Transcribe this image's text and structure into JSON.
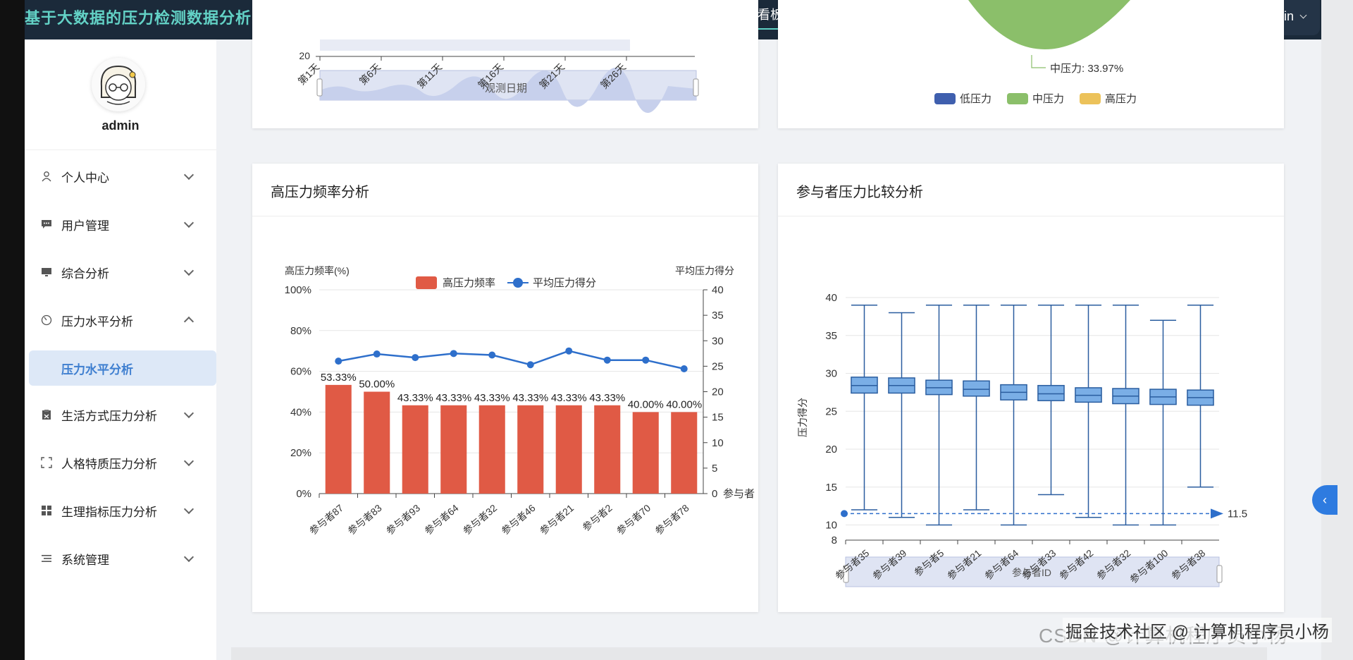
{
  "header": {
    "app_title": "基于大数据的压力检测数据分析系统",
    "dashboard_button": "数据看板",
    "user_name": "admin"
  },
  "sidebar": {
    "user_name": "admin",
    "items": [
      {
        "label": "个人中心",
        "icon": "user-icon",
        "expanded": false
      },
      {
        "label": "用户管理",
        "icon": "chat-icon",
        "expanded": false
      },
      {
        "label": "综合分析",
        "icon": "monitor-icon",
        "expanded": false
      },
      {
        "label": "压力水平分析",
        "icon": "gauge-icon",
        "expanded": true
      },
      {
        "label": "生活方式压力分析",
        "icon": "clipboard-icon",
        "expanded": false
      },
      {
        "label": "人格特质压力分析",
        "icon": "frame-icon",
        "expanded": false
      },
      {
        "label": "生理指标压力分析",
        "icon": "grid-icon",
        "expanded": false
      },
      {
        "label": "系统管理",
        "icon": "list-icon",
        "expanded": false
      }
    ],
    "active_subitem": "压力水平分析"
  },
  "top_left_chart": {
    "y_tick": "20",
    "x_ticks": [
      "第1天",
      "第6天",
      "第11天",
      "第16天",
      "第21天",
      "第26天"
    ],
    "x_label": "观测日期"
  },
  "top_right_chart": {
    "pie_label": "中压力: 33.97%",
    "legend": [
      {
        "name": "低压力",
        "color": "#3f5fae"
      },
      {
        "name": "中压力",
        "color": "#8bbf6a"
      },
      {
        "name": "高压力",
        "color": "#ecc25a"
      }
    ]
  },
  "cards": {
    "high_freq_title": "高压力频率分析",
    "compare_title": "参与者压力比较分析"
  },
  "chart_data": [
    {
      "type": "bar",
      "title": "高压力频率分析",
      "ylabel": "高压力频率(%)",
      "y2label": "平均压力得分",
      "ylim": [
        0,
        100
      ],
      "y2lim": [
        0,
        40
      ],
      "y_ticks": [
        "0%",
        "20%",
        "40%",
        "60%",
        "80%",
        "100%"
      ],
      "y2_ticks": [
        "0",
        "5",
        "10",
        "15",
        "20",
        "25",
        "30",
        "35",
        "40"
      ],
      "y2_axis_name_bottom": "参与者",
      "categories": [
        "参与者87",
        "参与者83",
        "参与者93",
        "参与者64",
        "参与者32",
        "参与者46",
        "参与者21",
        "参与者2",
        "参与者70",
        "参与者78"
      ],
      "legend": [
        "高压力频率",
        "平均压力得分"
      ],
      "series": [
        {
          "name": "高压力频率",
          "type": "bar",
          "values": [
            53.33,
            50.0,
            43.33,
            43.33,
            43.33,
            43.33,
            43.33,
            43.33,
            40.0,
            40.0
          ],
          "labels": [
            "53.33%",
            "50.00%",
            "43.33%",
            "43.33%",
            "43.33%",
            "43.33%",
            "43.33%",
            "43.33%",
            "40.00%",
            "40.00%"
          ]
        },
        {
          "name": "平均压力得分",
          "type": "line",
          "values": [
            26.0,
            27.4,
            26.7,
            27.5,
            27.2,
            25.3,
            28.0,
            26.2,
            26.2,
            24.5
          ]
        }
      ],
      "colors": {
        "bar": "#e05a45",
        "line": "#2e6fcb"
      }
    },
    {
      "type": "boxplot",
      "title": "参与者压力比较分析",
      "ylabel": "压力得分",
      "xlabel": "参与者ID",
      "ylim": [
        8,
        40
      ],
      "y_ticks": [
        "8",
        "10",
        "15",
        "20",
        "25",
        "30",
        "35",
        "40"
      ],
      "categories": [
        "参与者35",
        "参与者39",
        "参与者5",
        "参与者21",
        "参与者64",
        "参与者33",
        "参与者42",
        "参与者32",
        "参与者100",
        "参与者38"
      ],
      "boxes": [
        {
          "min": 12,
          "q1": 27.4,
          "median": 28.4,
          "q3": 29.5,
          "max": 39
        },
        {
          "min": 11,
          "q1": 27.4,
          "median": 28.4,
          "q3": 29.4,
          "max": 38
        },
        {
          "min": 10,
          "q1": 27.2,
          "median": 28.1,
          "q3": 29.1,
          "max": 39
        },
        {
          "min": 12,
          "q1": 27.0,
          "median": 27.9,
          "q3": 29.0,
          "max": 39
        },
        {
          "min": 10,
          "q1": 26.5,
          "median": 27.5,
          "q3": 28.5,
          "max": 39
        },
        {
          "min": 14,
          "q1": 26.4,
          "median": 27.3,
          "q3": 28.4,
          "max": 39
        },
        {
          "min": 11,
          "q1": 26.2,
          "median": 27.1,
          "q3": 28.1,
          "max": 39
        },
        {
          "min": 10,
          "q1": 26.0,
          "median": 27.0,
          "q3": 28.0,
          "max": 39
        },
        {
          "min": 10,
          "q1": 25.9,
          "median": 26.9,
          "q3": 27.9,
          "max": 37
        },
        {
          "min": 15,
          "q1": 25.8,
          "median": 26.8,
          "q3": 27.8,
          "max": 39
        }
      ],
      "mark_line": {
        "value": 11.5,
        "label": "11.5"
      },
      "colors": {
        "box_fill": "#7aaee6",
        "box_stroke": "#2a5d9f",
        "mark": "#2e6fcb"
      }
    }
  ],
  "watermark": "掘金技术社区 @ 计算机程序员小杨",
  "watermark_under": "CSDN @计算机程序员小杨"
}
